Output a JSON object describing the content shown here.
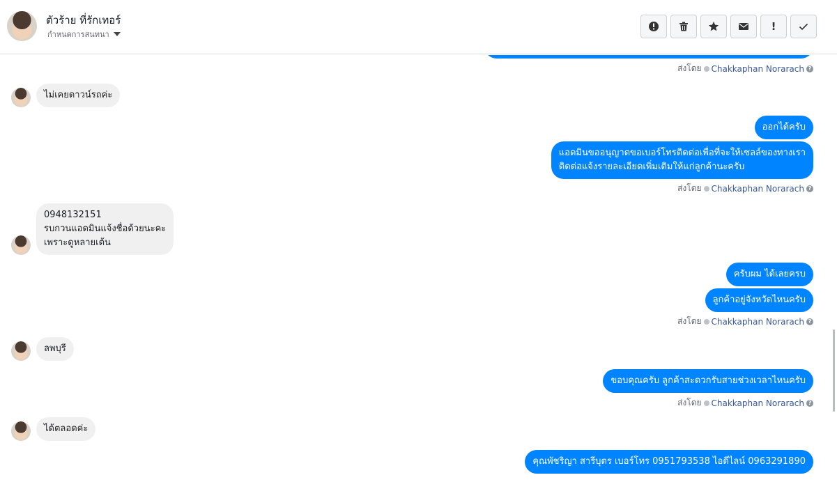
{
  "header": {
    "contact_name": "ตัวร้าย ที่รักเทอร์",
    "assign_label": "กำหนดการสนทนา",
    "toolbar": [
      {
        "name": "alert-button",
        "icon": "alert-circle-icon"
      },
      {
        "name": "delete-button",
        "icon": "trash-icon"
      },
      {
        "name": "star-button",
        "icon": "star-icon"
      },
      {
        "name": "mark-unread-button",
        "icon": "envelope-icon"
      },
      {
        "name": "spam-button",
        "icon": "exclamation-icon"
      },
      {
        "name": "done-button",
        "icon": "check-icon"
      }
    ]
  },
  "sent_by_prefix": "ส่งโดย",
  "sender_name": "Chakkaphan Norarach",
  "messages": {
    "in1": "ไม่เคยดาวน์รถค่ะ",
    "out1": "ออกได้ครับ",
    "out2": "แอดมินขออนุญาตขอเบอร์โทรติดต่อเพื่อที่จะให้เซลล์ของทางเรา\nติดต่อแจ้งรายละเอียดเพิ่มเติมให้แก่ลูกค้านะครับ",
    "in2": "0948132151\nรบกวนแอดมินแจ้งชื่อด้วยนะคะ\nเพราะดูหลายเต้น",
    "out3": "ครับผม ได้เลยครบ",
    "out4": "ลูกค้าอยู่จังหวัดไหนครับ",
    "in3": "ลพบุรี",
    "out5": "ขอบคุณครับ ลูกค้าสะดวกรับสายช่วงเวลาไหนครับ",
    "in4": "ได้ตลอดค่ะ",
    "out6": "คุณพัชริญา สารีบุตร        เบอร์โทร 0951793538  ไอดีไลน์ 0963291890"
  },
  "colors": {
    "outgoing_bubble": "#0084ff",
    "incoming_bubble": "#f1f0f0",
    "sender_link": "#385898"
  }
}
